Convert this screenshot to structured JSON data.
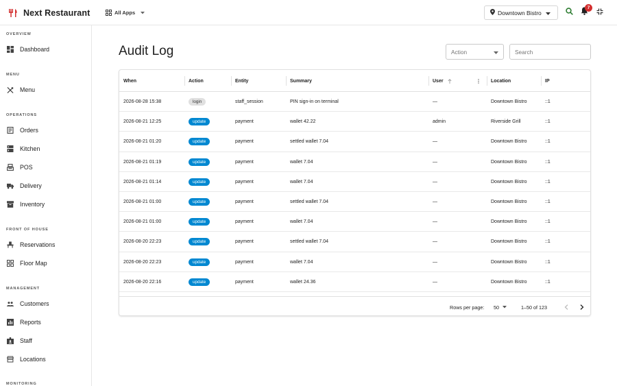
{
  "app": {
    "title": "Next Restaurant",
    "apps_label": "All Apps",
    "location": "Downtown Bistro",
    "notifications_count": "7"
  },
  "colors": {
    "accent": "#d32f2f",
    "update_chip": "#0288d1",
    "login_chip": "#e0e0e0",
    "search_icon": "#2e7d32"
  },
  "sidebar": {
    "sections": [
      {
        "label": "OVERVIEW",
        "items": [
          {
            "label": "Dashboard",
            "icon": "dashboard-icon"
          }
        ]
      },
      {
        "label": "MENU",
        "items": [
          {
            "label": "Menu",
            "icon": "utensils-icon"
          }
        ]
      },
      {
        "label": "OPERATIONS",
        "items": [
          {
            "label": "Orders",
            "icon": "receipt-icon"
          },
          {
            "label": "Kitchen",
            "icon": "kitchen-icon"
          },
          {
            "label": "POS",
            "icon": "register-icon"
          },
          {
            "label": "Delivery",
            "icon": "truck-icon"
          },
          {
            "label": "Inventory",
            "icon": "inventory-icon"
          }
        ]
      },
      {
        "label": "FRONT OF HOUSE",
        "items": [
          {
            "label": "Reservations",
            "icon": "seat-icon"
          },
          {
            "label": "Floor Map",
            "icon": "grid-icon"
          }
        ]
      },
      {
        "label": "MANAGEMENT",
        "items": [
          {
            "label": "Customers",
            "icon": "people-icon"
          },
          {
            "label": "Reports",
            "icon": "chart-icon"
          },
          {
            "label": "Staff",
            "icon": "badge-icon"
          },
          {
            "label": "Locations",
            "icon": "store-icon"
          }
        ]
      },
      {
        "label": "MONITORING",
        "items": []
      }
    ]
  },
  "page": {
    "title": "Audit Log",
    "action_filter": "Action",
    "search_placeholder": "Search"
  },
  "table": {
    "columns": [
      "When",
      "Action",
      "Entity",
      "Summary",
      "User",
      "Location",
      "IP"
    ],
    "rows": [
      {
        "when": "2026-08-28 15:38",
        "action": "login",
        "entity": "staff_session",
        "summary": "PIN sign-in on terminal",
        "user": "—",
        "location": "Downtown Bistro",
        "ip": "::1"
      },
      {
        "when": "2026-08-21 12:25",
        "action": "update",
        "entity": "payment",
        "summary": "wallet 42.22",
        "user": "admin",
        "location": "Riverside Grill",
        "ip": "::1"
      },
      {
        "when": "2026-08-21 01:20",
        "action": "update",
        "entity": "payment",
        "summary": "settled wallet 7.04",
        "user": "—",
        "location": "Downtown Bistro",
        "ip": "::1"
      },
      {
        "when": "2026-08-21 01:19",
        "action": "update",
        "entity": "payment",
        "summary": "wallet 7.04",
        "user": "—",
        "location": "Downtown Bistro",
        "ip": "::1"
      },
      {
        "when": "2026-08-21 01:14",
        "action": "update",
        "entity": "payment",
        "summary": "wallet 7.04",
        "user": "—",
        "location": "Downtown Bistro",
        "ip": "::1"
      },
      {
        "when": "2026-08-21 01:00",
        "action": "update",
        "entity": "payment",
        "summary": "settled wallet 7.04",
        "user": "—",
        "location": "Downtown Bistro",
        "ip": "::1"
      },
      {
        "when": "2026-08-21 01:00",
        "action": "update",
        "entity": "payment",
        "summary": "wallet 7.04",
        "user": "—",
        "location": "Downtown Bistro",
        "ip": "::1"
      },
      {
        "when": "2026-08-20 22:23",
        "action": "update",
        "entity": "payment",
        "summary": "settled wallet 7.04",
        "user": "—",
        "location": "Downtown Bistro",
        "ip": "::1"
      },
      {
        "when": "2026-08-20 22:23",
        "action": "update",
        "entity": "payment",
        "summary": "wallet 7.04",
        "user": "—",
        "location": "Downtown Bistro",
        "ip": "::1"
      },
      {
        "when": "2026-08-20 22:16",
        "action": "update",
        "entity": "payment",
        "summary": "wallet 24.36",
        "user": "—",
        "location": "Downtown Bistro",
        "ip": "::1"
      }
    ]
  },
  "pagination": {
    "rows_per_page_label": "Rows per page:",
    "rows_per_page": "50",
    "range": "1–50 of 123"
  }
}
